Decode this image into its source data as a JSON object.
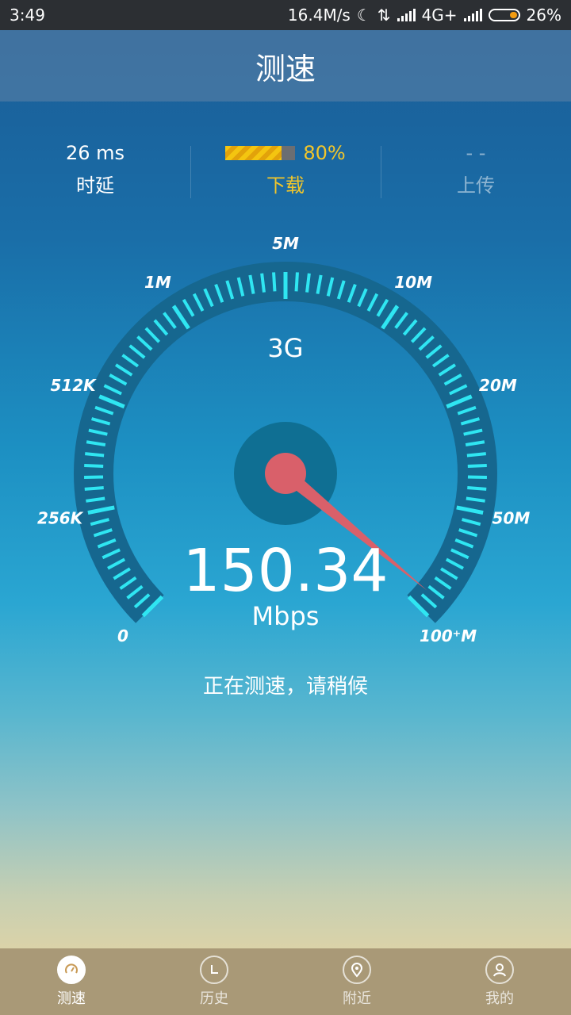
{
  "status_bar": {
    "time": "3:49",
    "net_speed": "16.4M/s",
    "network": "4G+",
    "battery": "26%",
    "battery_level": 0.26
  },
  "header": {
    "title": "测速"
  },
  "stats": {
    "latency": {
      "value": "26 ms",
      "label": "时延"
    },
    "download": {
      "percent": "80%",
      "progress": 0.8,
      "label": "下载"
    },
    "upload": {
      "value": "- -",
      "label": "上传"
    }
  },
  "gauge": {
    "network_type": "3G",
    "scale_labels": [
      "0",
      "256K",
      "512K",
      "1M",
      "5M",
      "10M",
      "20M",
      "50M",
      "100⁺M"
    ],
    "needle_fraction": 0.98,
    "accent_color": "#2fe6f2",
    "needle_color": "#d9606a"
  },
  "speed": {
    "value": "150.34",
    "unit": "Mbps"
  },
  "message": "正在测速，请稍候",
  "nav": {
    "items": [
      {
        "label": "测速",
        "icon": "speedometer-icon",
        "active": true
      },
      {
        "label": "历史",
        "icon": "history-icon",
        "active": false
      },
      {
        "label": "附近",
        "icon": "location-pin-icon",
        "active": false
      },
      {
        "label": "我的",
        "icon": "profile-icon",
        "active": false
      }
    ]
  }
}
